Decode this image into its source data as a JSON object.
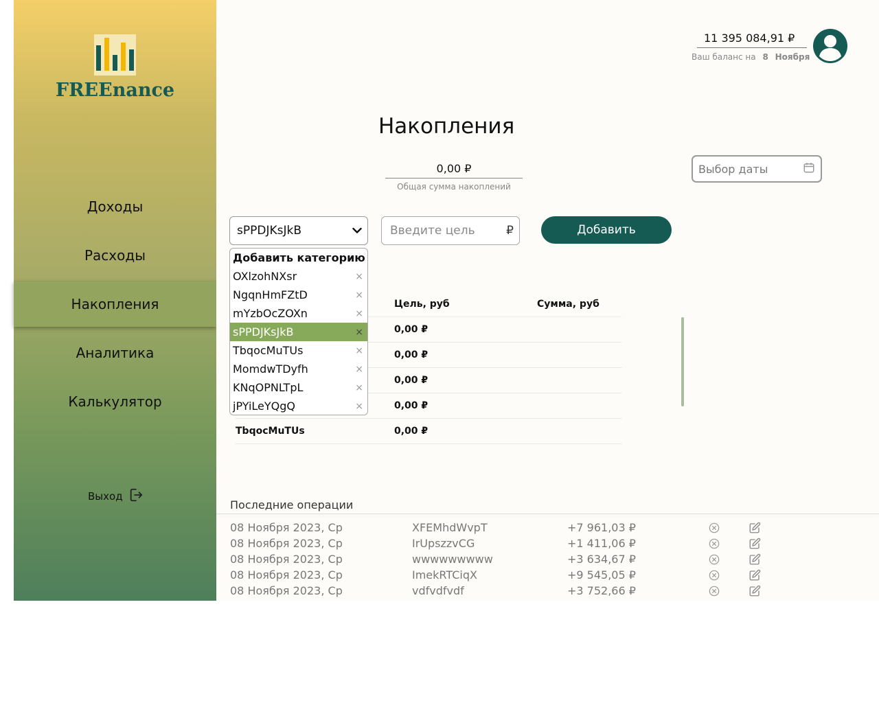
{
  "brand": {
    "name": "FREEnance"
  },
  "nav": {
    "items": [
      {
        "label": "Доходы",
        "active": false
      },
      {
        "label": "Расходы",
        "active": false
      },
      {
        "label": "Накопления",
        "active": true
      },
      {
        "label": "Аналитика",
        "active": false
      },
      {
        "label": "Калькулятор",
        "active": false
      }
    ],
    "logout_label": "Выход"
  },
  "header": {
    "balance": "11 395 084,91 ₽",
    "balance_caption": "Ваш баланс на",
    "balance_day": "8",
    "balance_month": "Ноября"
  },
  "page": {
    "title": "Накопления",
    "total_value": "0,00 ₽",
    "total_caption": "Общая сумма накоплений",
    "date_placeholder": "Выбор даты"
  },
  "form": {
    "category_selected": "sPPDJKsJkB",
    "goal_placeholder": "Введите цель",
    "currency": "₽",
    "add_label": "Добавить"
  },
  "dropdown": {
    "header": "Добавить категорию",
    "items": [
      {
        "label": "OXlzohNXsr",
        "selected": false
      },
      {
        "label": "NgqnHmFZtD",
        "selected": false
      },
      {
        "label": "mYzbOcZOXn",
        "selected": false
      },
      {
        "label": "sPPDJKsJkB",
        "selected": true
      },
      {
        "label": "TbqocMuTUs",
        "selected": false
      },
      {
        "label": "MomdwTDyfh",
        "selected": false
      },
      {
        "label": "KNqOPNLTpL",
        "selected": false
      },
      {
        "label": "jPYiLeYQgQ",
        "selected": false
      }
    ],
    "remove_glyph": "×"
  },
  "table": {
    "headers": [
      "",
      "Цель, руб",
      "Сумма, руб"
    ],
    "rows": [
      {
        "name": "",
        "goal": "0,00 ₽",
        "sum": ""
      },
      {
        "name": "",
        "goal": "0,00 ₽",
        "sum": ""
      },
      {
        "name": "",
        "goal": "0,00 ₽",
        "sum": ""
      },
      {
        "name": "",
        "goal": "0,00 ₽",
        "sum": ""
      },
      {
        "name": "TbqocMuTUs",
        "goal": "0,00 ₽",
        "sum": ""
      }
    ]
  },
  "operations": {
    "title": "Последние операции",
    "rows": [
      {
        "date": "08 Ноября 2023, Ср",
        "name": "XFEMhdWvpT",
        "amount": "+7 961,03 ₽"
      },
      {
        "date": "08 Ноября 2023, Ср",
        "name": "IrUpszzvCG",
        "amount": "+1 411,06 ₽"
      },
      {
        "date": "08 Ноября 2023, Ср",
        "name": "wwwwwwwww",
        "amount": "+3 634,67 ₽"
      },
      {
        "date": "08 Ноября 2023, Ср",
        "name": "ImekRTCiqX",
        "amount": "+9 545,05 ₽"
      },
      {
        "date": "08 Ноября 2023, Ср",
        "name": "vdfvdfvdf",
        "amount": "+3 752,66 ₽"
      }
    ]
  },
  "colors": {
    "brand": "#155a53",
    "accent_selected": "#86a95a",
    "nav_active": "#93a45e"
  }
}
